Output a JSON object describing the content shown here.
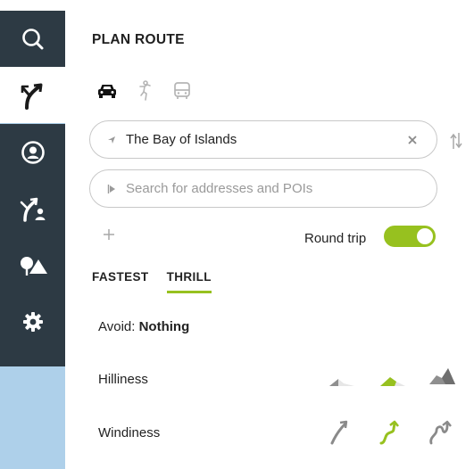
{
  "sidebar": {
    "items": [
      {
        "name": "search",
        "icon": "search-icon",
        "active": false
      },
      {
        "name": "plan-route",
        "icon": "route-icon",
        "active": true
      },
      {
        "name": "profile",
        "icon": "user-icon",
        "active": false
      },
      {
        "name": "routes-users",
        "icon": "route-people-icon",
        "active": false
      },
      {
        "name": "places",
        "icon": "scenery-icon",
        "active": false
      },
      {
        "name": "settings",
        "icon": "gear-icon",
        "active": false
      }
    ]
  },
  "header": {
    "title": "PLAN ROUTE"
  },
  "transport_modes": [
    {
      "icon": "car-icon",
      "active": true
    },
    {
      "icon": "bicycle-icon",
      "active": false
    },
    {
      "icon": "bus-icon",
      "active": false
    }
  ],
  "route": {
    "start_value": "The Bay of Islands",
    "destination_placeholder": "Search for addresses and POIs",
    "round_trip_label": "Round trip",
    "round_trip_enabled": true
  },
  "tabs": [
    {
      "label": "FASTEST",
      "active": false
    },
    {
      "label": "THRILL",
      "active": true
    }
  ],
  "options": {
    "avoid_prefix": "Avoid:",
    "avoid_value": "Nothing",
    "hilliness_label": "Hilliness",
    "hilliness_selected": 2,
    "windiness_label": "Windiness",
    "windiness_selected": 2
  },
  "colors": {
    "accent": "#97c11f",
    "sidebar_dark": "#2d3a44",
    "sidebar_light": "#aed0ea"
  }
}
